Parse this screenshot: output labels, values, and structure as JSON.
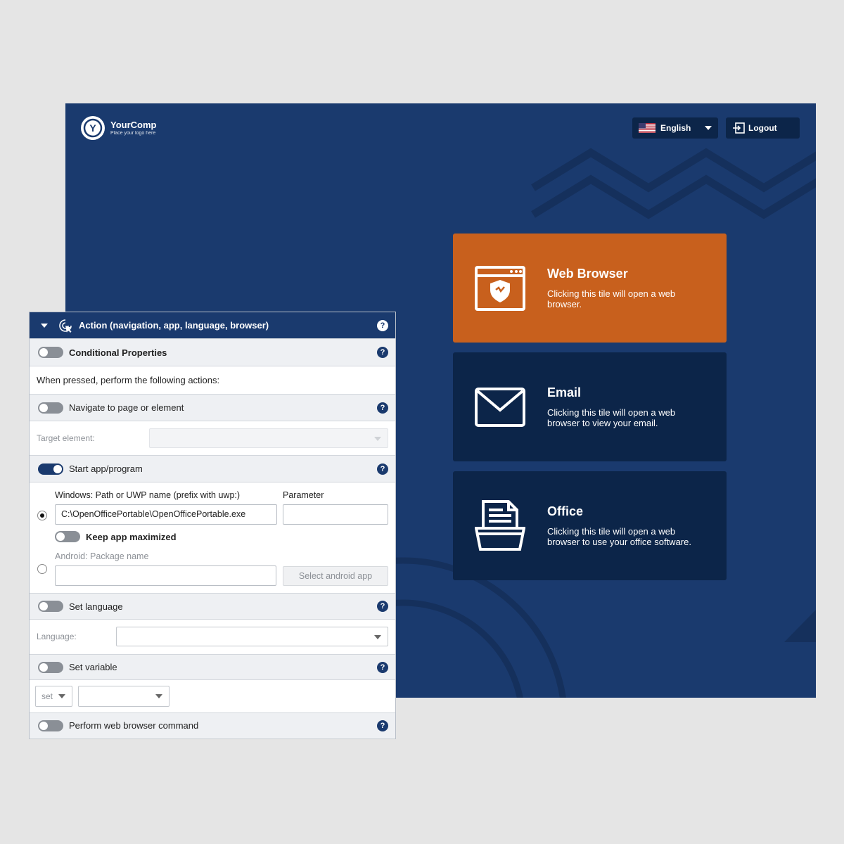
{
  "kiosk": {
    "logo_name": "YourComp",
    "logo_tagline": "Place your logo here",
    "language_label": "English",
    "logout_label": "Logout",
    "tiles": [
      {
        "title": "Web Browser",
        "desc": "Clicking this tile will open a web browser.",
        "icon": "browser-shield-icon",
        "color": "#c8601d"
      },
      {
        "title": "Email",
        "desc": "Clicking this tile will open a web browser to view your email.",
        "icon": "envelope-icon",
        "color": "#0c2549"
      },
      {
        "title": "Office",
        "desc": "Clicking this tile will open a web browser to use your office software.",
        "icon": "document-tray-icon",
        "color": "#0c2549"
      }
    ],
    "background_color": "#1a3a6e"
  },
  "panel": {
    "header_title": "Action (navigation, app, language, browser)",
    "help_glyph": "?",
    "conditional_label": "Conditional Properties",
    "instruction": "When pressed, perform the following actions:",
    "navigate_label": "Navigate to page or element",
    "target_label": "Target element:",
    "start_app_label": "Start app/program",
    "windows_path_label": "Windows: Path or UWP name (prefix with uwp:)",
    "parameter_label": "Parameter",
    "windows_path_value": "C:\\OpenOfficePortable\\OpenOfficePortable.exe",
    "keep_maximized_label": "Keep app maximized",
    "android_label": "Android: Package name",
    "select_android_label": "Select android app",
    "set_language_label": "Set language",
    "language_field_label": "Language:",
    "set_variable_label": "Set variable",
    "set_option": "set",
    "browser_command_label": "Perform web browser command"
  }
}
